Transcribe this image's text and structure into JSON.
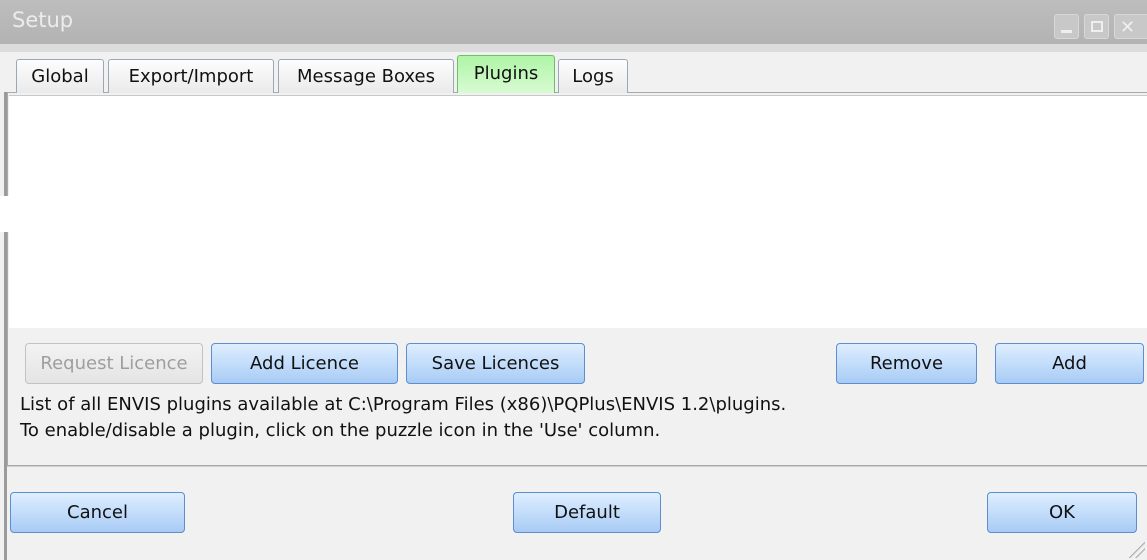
{
  "window": {
    "title": "Setup"
  },
  "tabs": [
    {
      "label": "Global"
    },
    {
      "label": "Export/Import"
    },
    {
      "label": "Message Boxes"
    },
    {
      "label": "Plugins"
    },
    {
      "label": "Logs"
    }
  ],
  "active_tab": "Plugins",
  "plugin_buttons": {
    "request_licence": "Request Licence",
    "add_licence": "Add Licence",
    "save_licences": "Save Licences",
    "remove": "Remove",
    "add": "Add"
  },
  "info": {
    "line1": "List of all ENVIS plugins available at C:\\Program Files (x86)\\PQPlus\\ENVIS 1.2\\plugins.",
    "line2": "To enable/disable a plugin, click on the puzzle icon in the 'Use' column."
  },
  "footer": {
    "cancel": "Cancel",
    "default": "Default",
    "ok": "OK"
  },
  "colors": {
    "accent_tab": "#aef5a6",
    "button": "#c3ddfb",
    "titlebar": "#b8b8b8"
  }
}
